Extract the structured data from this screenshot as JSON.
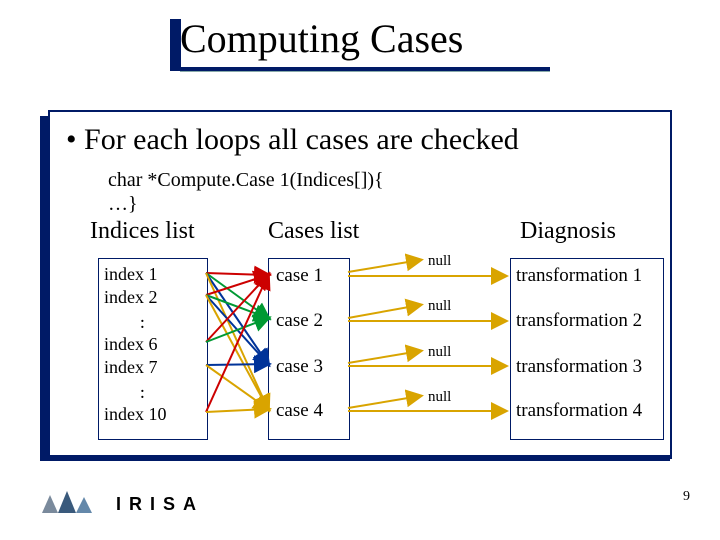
{
  "title": "Computing Cases",
  "bullet": "•  For each loops all cases are checked",
  "code_line1": "char *Compute.Case 1(Indices[]){",
  "code_line2": "…}",
  "headers": {
    "indices": "Indices list",
    "cases": "Cases list",
    "diagnosis": "Diagnosis"
  },
  "indices": [
    "index 1",
    "index 2",
    "index 6",
    "index 7",
    "index 10"
  ],
  "cases": [
    "case 1",
    "case 2",
    "case 3",
    "case 4"
  ],
  "null_label": "null",
  "transformations": [
    "transformation 1",
    "transformation 2",
    "transformation 3",
    "transformation 4"
  ],
  "logo_text": "IRISA",
  "page_number": "9"
}
